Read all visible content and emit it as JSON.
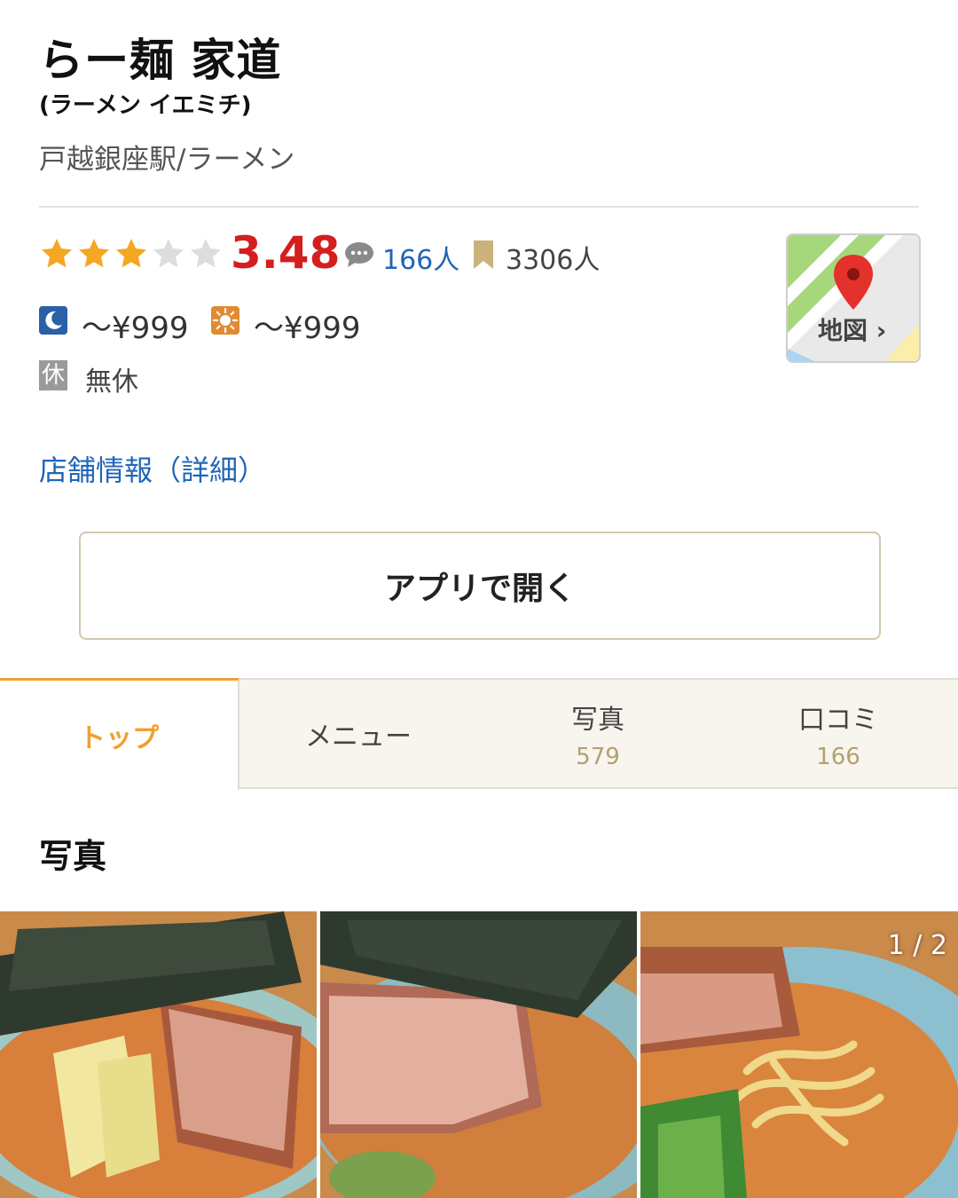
{
  "restaurant": {
    "name": "らー麺 家道",
    "kana": "(ラーメン イエミチ)",
    "area_genre": "戸越銀座駅/ラーメン",
    "rating": "3.48",
    "rating_stars": 3.48,
    "review_count": "166人",
    "bookmark_count": "3306人",
    "price_dinner": "～¥999",
    "price_lunch": "～¥999",
    "holiday_badge": "休",
    "holiday": "無休"
  },
  "map": {
    "label": "地図 ›"
  },
  "links": {
    "detail": "店舗情報（詳細）"
  },
  "actions": {
    "open_app": "アプリで開く"
  },
  "tabs": [
    {
      "label": "トップ",
      "count": ""
    },
    {
      "label": "メニュー",
      "count": ""
    },
    {
      "label": "写真",
      "count": "579"
    },
    {
      "label": "口コミ",
      "count": "166"
    }
  ],
  "photos": {
    "heading": "写真",
    "pager": "1 / 2"
  },
  "colors": {
    "accent": "#f0a030",
    "score": "#d51e1e",
    "link": "#2166b8",
    "star_on": "#f5a623",
    "star_off": "#dddddd"
  }
}
